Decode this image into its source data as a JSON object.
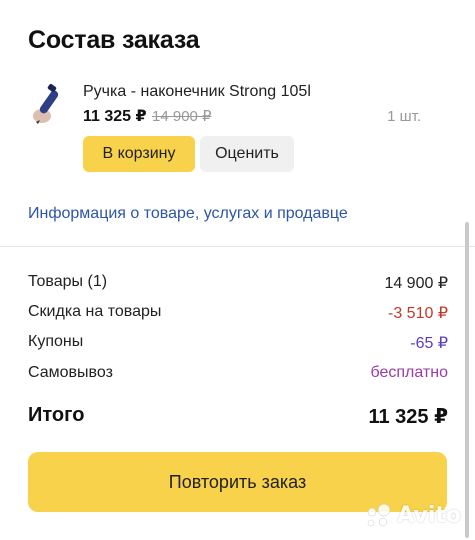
{
  "page": {
    "title": "Состав заказа"
  },
  "product": {
    "image_icon": "stylus-pen-icon",
    "name": "Ручка - наконечник Strong 105l",
    "price": "11 325 ₽",
    "old_price": "14 900 ₽",
    "quantity": "1 шт."
  },
  "actions": {
    "cart_label": "В корзину",
    "rate_label": "Оценить"
  },
  "info_link": "Информация о товаре, услугах и продавце",
  "summary": {
    "rows": [
      {
        "label": "Товары (1)",
        "value": "14 900 ₽"
      },
      {
        "label": "Скидка на товары",
        "value": "-3 510 ₽"
      },
      {
        "label": "Купоны",
        "value": "-65 ₽"
      },
      {
        "label": "Самовывоз",
        "value": "бесплатно"
      }
    ],
    "total_label": "Итого",
    "total_value": "11 325 ₽"
  },
  "repeat_button": "Повторить заказ",
  "watermark": {
    "icon": "avito-logo-icon",
    "text": "Avito"
  },
  "colors": {
    "accent_yellow": "#f8d24a",
    "link_blue": "#2c55a8",
    "discount_red": "#c0392b",
    "coupon_purple": "#5a3fc0",
    "free_magenta": "#9b3aa8"
  }
}
